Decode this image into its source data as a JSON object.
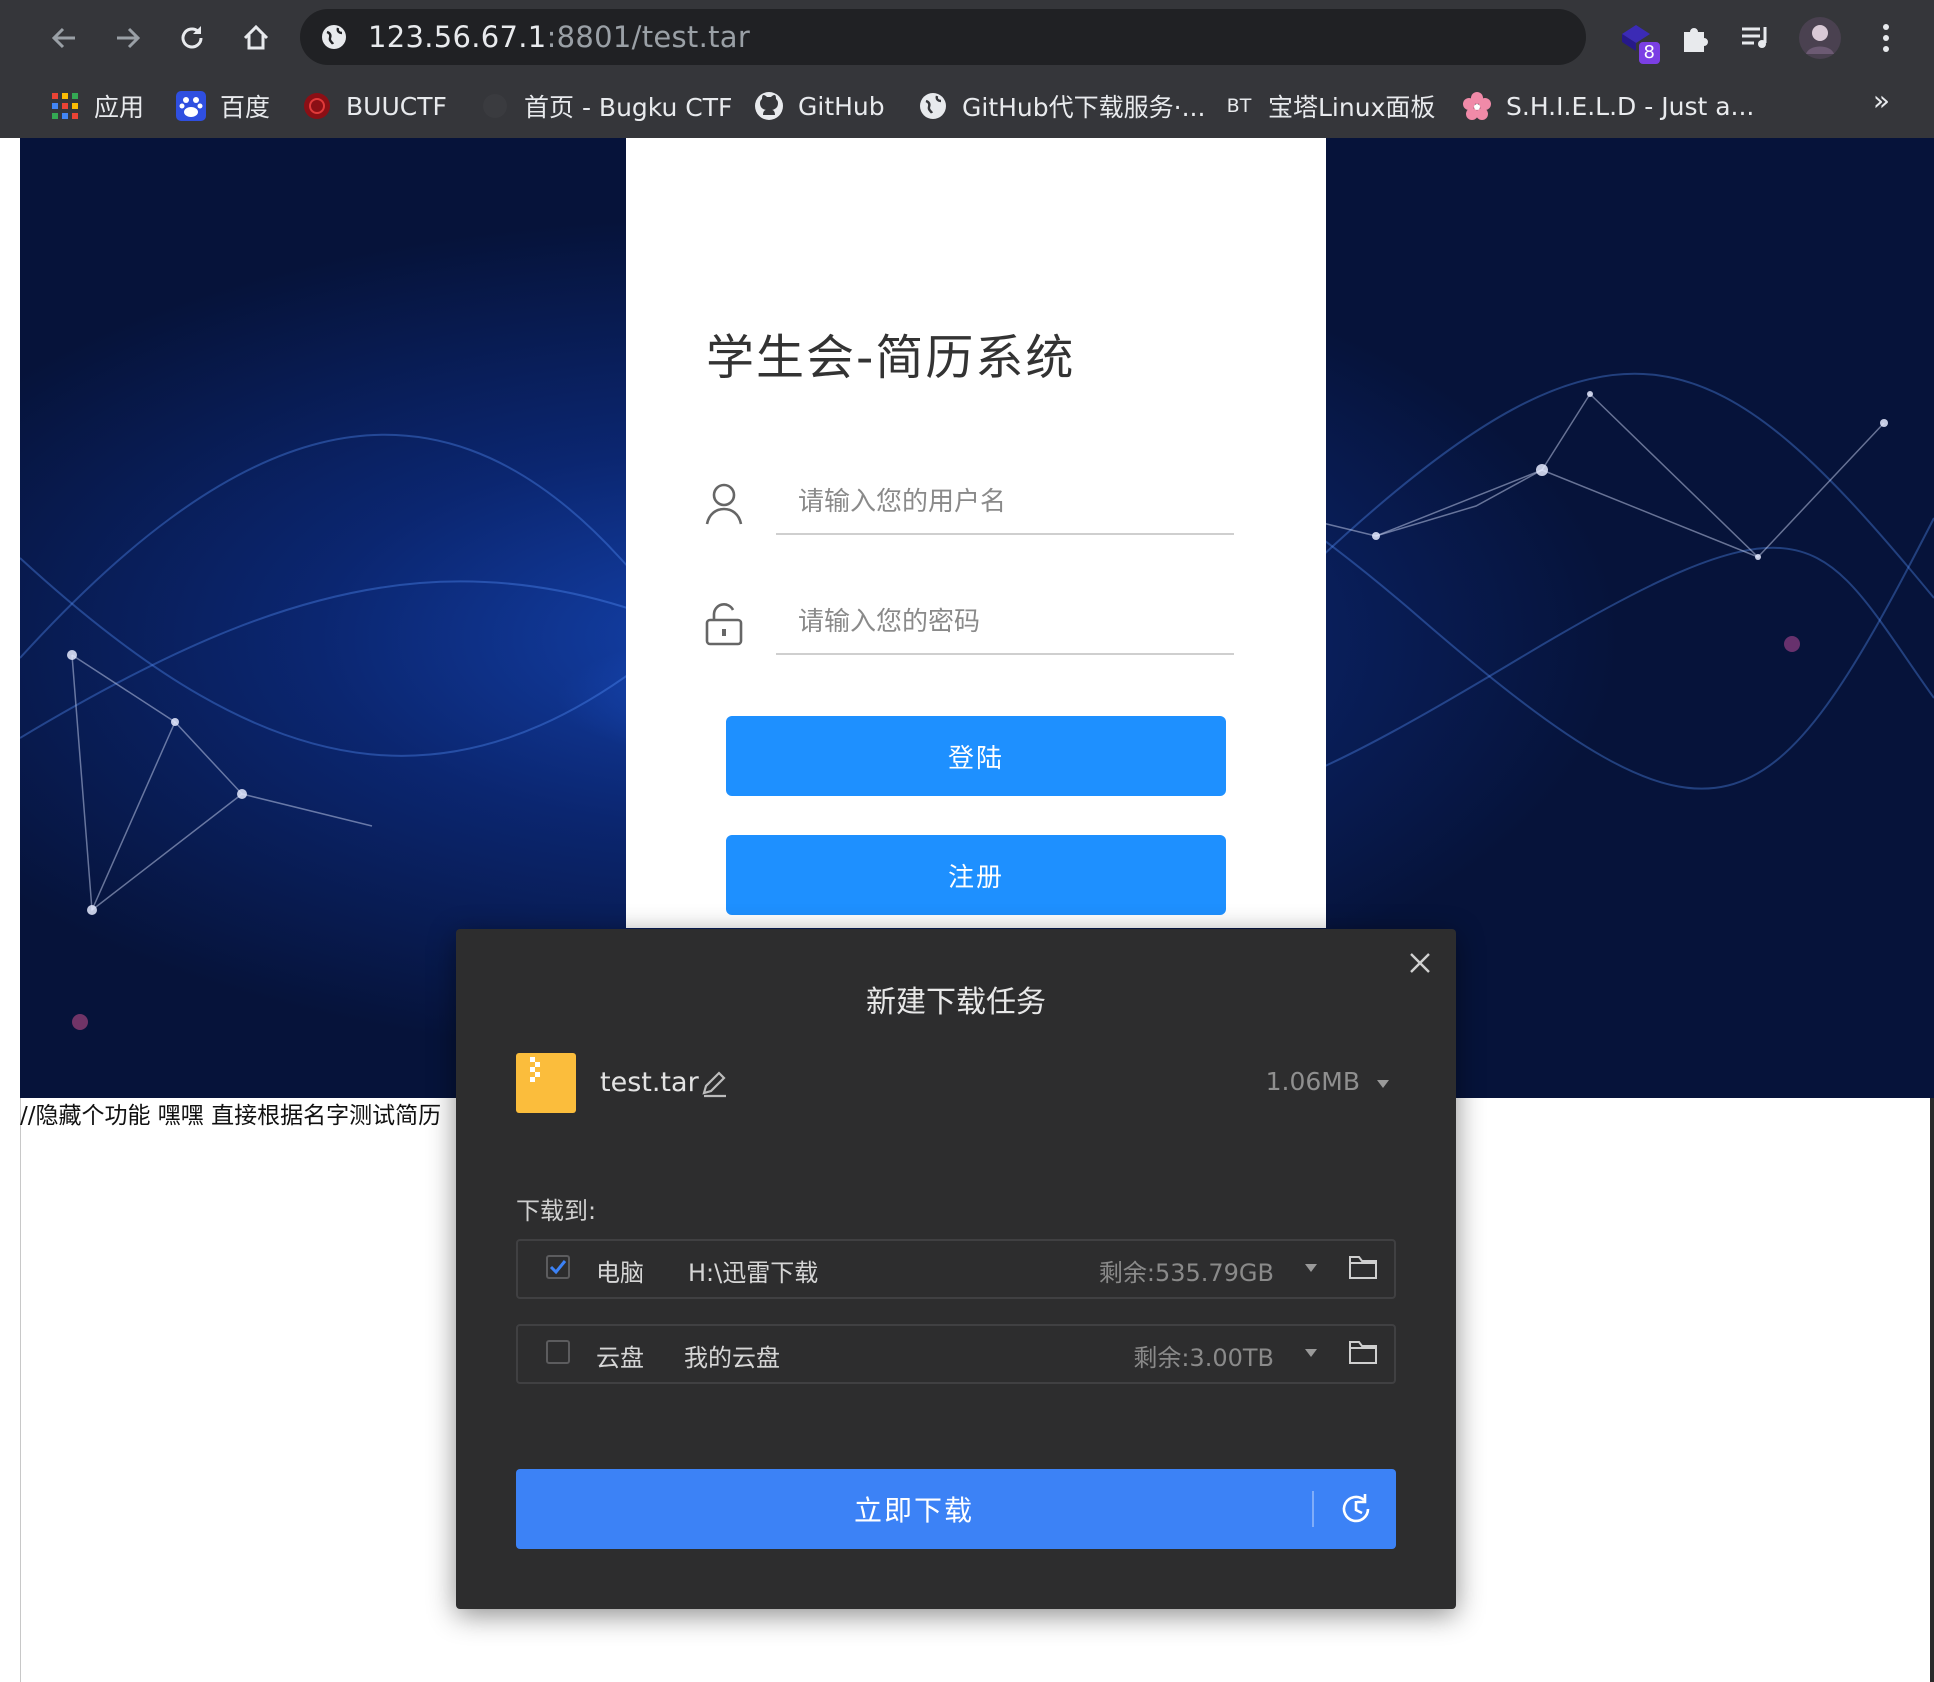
{
  "browser": {
    "url_host": "123.56.67.1",
    "url_rest": ":8801/test.tar",
    "extension_badge": "8",
    "bookmarks": [
      {
        "label": "应用",
        "icon": "apps-grid-icon"
      },
      {
        "label": "百度",
        "icon": "baidu-icon"
      },
      {
        "label": "BUUCTF",
        "icon": "buuctf-icon"
      },
      {
        "label": "首页 - Bugku CTF",
        "icon": "bugku-icon"
      },
      {
        "label": "GitHub",
        "icon": "github-icon"
      },
      {
        "label": "GitHub代下载服务·...",
        "icon": "globe-icon"
      },
      {
        "label": "宝塔Linux面板",
        "icon": "bt-icon"
      },
      {
        "label": "S.H.I.E.L.D - Just a...",
        "icon": "flower-icon"
      }
    ],
    "bt_icon_text": "BT",
    "more_bookmarks": "»"
  },
  "login": {
    "title": "学生会-简历系统",
    "username_placeholder": "请输入您的用户名",
    "password_placeholder": "请输入您的密码",
    "login_button": "登陆",
    "register_button": "注册"
  },
  "page_comment": "//隐藏个功能 嘿嘿 直接根据名字测试简历",
  "download_dialog": {
    "title": "新建下载任务",
    "file_name": "test.tar",
    "file_size": "1.06MB",
    "save_to_label": "下载到:",
    "destinations": [
      {
        "type": "电脑",
        "path": "H:\\迅雷下载",
        "free": "剩余:535.79GB",
        "checked": true
      },
      {
        "type": "云盘",
        "path": "我的云盘",
        "free": "剩余:3.00TB",
        "checked": false
      }
    ],
    "download_button": "立即下载"
  },
  "colors": {
    "chrome_bg": "#35363a",
    "primary_button": "#1e90ff",
    "download_button": "#3c82f6",
    "dialog_bg": "#2d2d2e",
    "file_icon": "#fbbd3c"
  }
}
